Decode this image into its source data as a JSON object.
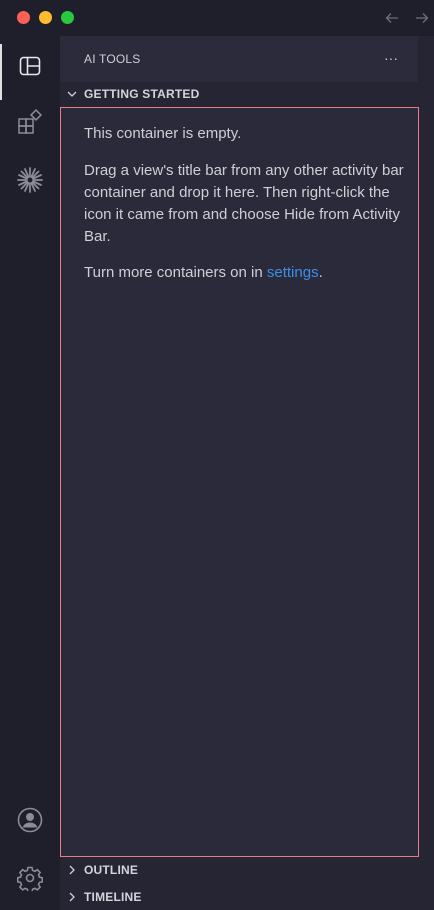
{
  "sidebar": {
    "title": "AI TOOLS",
    "more_label": "···",
    "sections": {
      "getting_started": "GETTING STARTED",
      "outline": "OUTLINE",
      "timeline": "TIMELINE"
    }
  },
  "empty": {
    "line1": "This container is empty.",
    "line2": "Drag a view's title bar from any other activity bar container and drop it here. Then right-click the icon it came from and choose Hide from Activity Bar.",
    "line3_prefix": "Turn more containers on in ",
    "line3_link": "settings",
    "line3_suffix": "."
  },
  "colors": {
    "accent_link": "#3b8eea",
    "panel_border": "#e87a8a"
  },
  "icons": {
    "activity": [
      "layout-panel-icon",
      "extensions-icon",
      "sparkle-icon"
    ],
    "bottom": [
      "account-icon",
      "gear-icon"
    ],
    "titlebar": [
      "arrow-left-icon",
      "arrow-right-icon"
    ]
  }
}
